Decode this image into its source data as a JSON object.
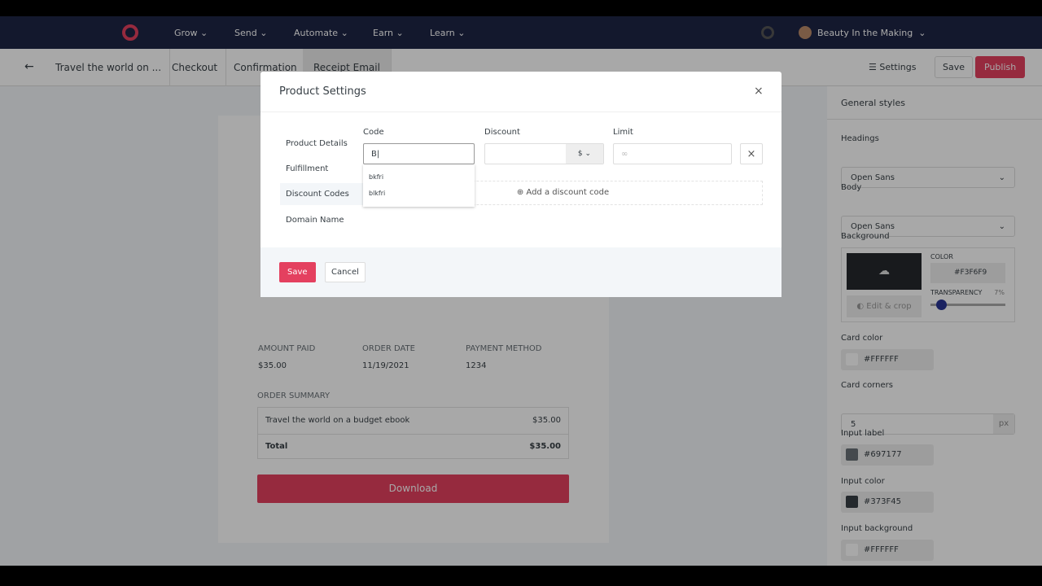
{
  "nav": {
    "items": [
      "Grow",
      "Send",
      "Automate",
      "Earn",
      "Learn"
    ],
    "account": "Beauty In the Making"
  },
  "toolbar": {
    "back": "←",
    "title": "Travel the world on ...",
    "tabs": [
      "Checkout",
      "Confirmation",
      "Receipt Email"
    ],
    "settings": "Settings",
    "save": "Save",
    "publish": "Publish"
  },
  "receipt": {
    "amount_label": "AMOUNT PAID",
    "amount": "$35.00",
    "date_label": "ORDER DATE",
    "date": "11/19/2021",
    "method_label": "PAYMENT METHOD",
    "method": "1234",
    "summary_label": "ORDER SUMMARY",
    "item": "Travel the world on a budget ebook",
    "item_price": "$35.00",
    "total_label": "Total",
    "total": "$35.00",
    "download": "Download"
  },
  "panel": {
    "title": "General styles",
    "headings_label": "Headings",
    "headings_font": "Open Sans",
    "body_label": "Body",
    "body_font": "Open Sans",
    "background_label": "Background",
    "color_label": "COLOR",
    "bg_color": "#F3F6F9",
    "transparency_label": "TRANSPARENCY",
    "transparency": "7%",
    "transparency_value": 7,
    "edit_crop": "Edit & crop",
    "card_color_label": "Card color",
    "card_color": "#FFFFFF",
    "card_corners_label": "Card corners",
    "card_corners": "5",
    "card_corners_unit": "px",
    "input_label_label": "Input label",
    "input_label_color": "#697177",
    "input_color_label": "Input color",
    "input_color": "#373F45",
    "input_bg_label": "Input background",
    "input_bg": "#FFFFFF"
  },
  "modal": {
    "title": "Product Settings",
    "nav": [
      "Product Details",
      "Fulfillment",
      "Discount Codes",
      "Domain Name"
    ],
    "code_label": "Code",
    "code_value": "B",
    "discount_label": "Discount",
    "currency": "$",
    "limit_label": "Limit",
    "limit_placeholder": "∞",
    "suggestions": [
      "bkfri",
      "blkfri"
    ],
    "add_code": "Add a discount code",
    "save": "Save",
    "cancel": "Cancel"
  },
  "colors": {
    "accent": "#e4405f",
    "nav_bg": "#1e2545"
  }
}
